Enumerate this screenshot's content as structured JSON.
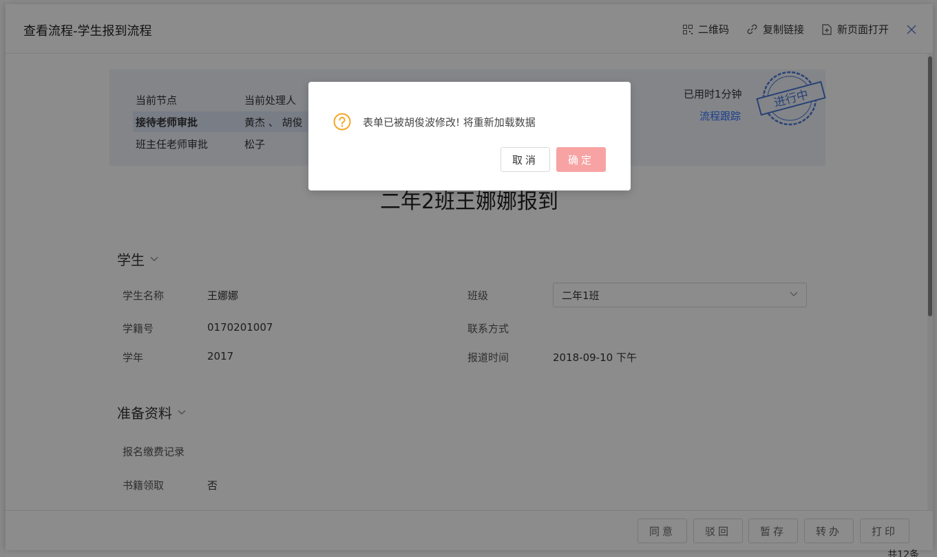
{
  "drawer": {
    "title": "查看流程-学生报到流程",
    "actions": {
      "qrcode": "二维码",
      "copy_link": "复制链接",
      "new_page": "新页面打开"
    }
  },
  "status": {
    "col1_header": "当前节点",
    "col2_header": "当前处理人",
    "rows": [
      {
        "node": "接待老师审批",
        "handler": "黄杰 、 胡俊"
      },
      {
        "node": "班主任老师审批",
        "handler": "松子"
      }
    ],
    "elapsed": "已用时1分钟",
    "trace_link": "流程跟踪",
    "stamp_text": "进行中"
  },
  "form": {
    "title": "二年2班王娜娜报到",
    "sections": {
      "student": "学生",
      "materials": "准备资料"
    },
    "fields": {
      "name_label": "学生名称",
      "name_value": "王娜娜",
      "id_label": "学籍号",
      "id_value": "0170201007",
      "year_label": "学年",
      "year_value": "2017",
      "class_label": "班级",
      "class_value": "二年1班",
      "contact_label": "联系方式",
      "report_time_label": "报道时间",
      "report_time_value": "2018-09-10 下午",
      "fee_label": "报名缴费记录",
      "books_label": "书籍领取",
      "books_value": "否"
    }
  },
  "footer": {
    "agree": "同意",
    "reject": "驳回",
    "save": "暂存",
    "transfer": "转办",
    "print": "打印"
  },
  "background": {
    "page_count": "共12条"
  },
  "dialog": {
    "message": "表单已被胡俊波修改! 将重新加载数据",
    "cancel": "取消",
    "ok": "确定"
  },
  "colors": {
    "accent": "#3370ff",
    "ok_button": "#f7a3a3",
    "warning_icon": "#f5a623"
  }
}
